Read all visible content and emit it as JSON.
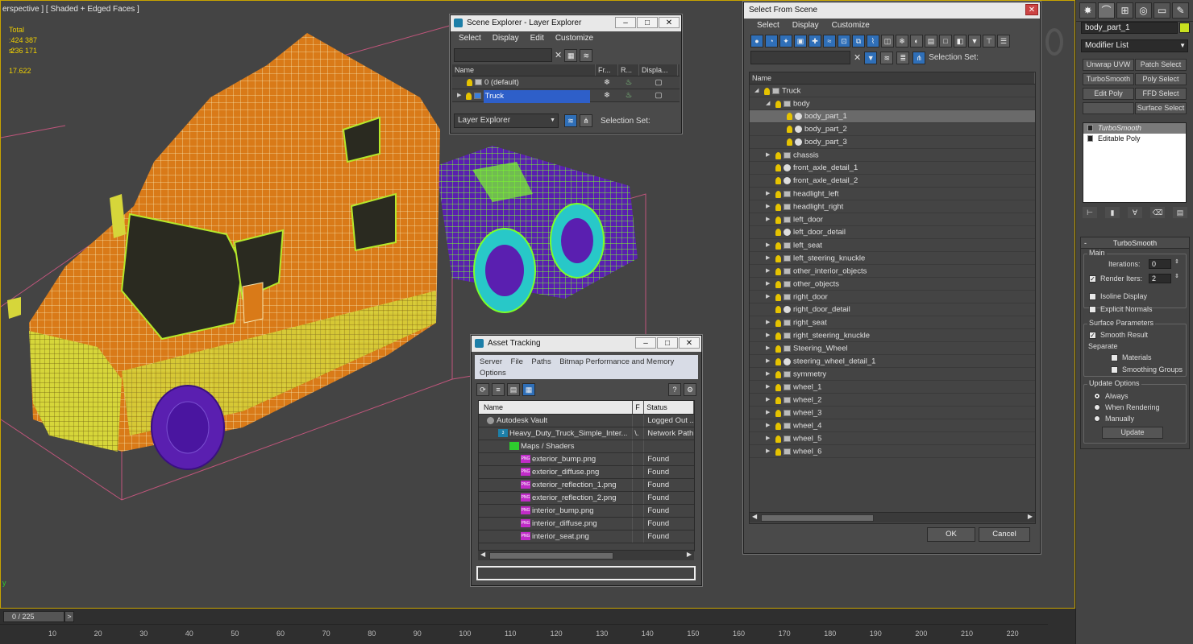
{
  "viewport": {
    "label": "erspective ] [ Shaded + Edged Faces ]",
    "stats": [
      {
        "name": "Total",
        "value": ""
      },
      {
        "name": ":",
        "value": "424 387"
      },
      {
        "name": "s:",
        "value": "236 171"
      },
      {
        "name": "",
        "value": "17.622"
      }
    ],
    "axis": "y"
  },
  "timeline": {
    "frame": "0 / 225",
    "next": ">",
    "ticks": [
      "10",
      "20",
      "30",
      "40",
      "50",
      "60",
      "70",
      "80",
      "90",
      "100",
      "110",
      "120",
      "130",
      "140",
      "150",
      "160",
      "170",
      "180",
      "190",
      "200",
      "210",
      "220"
    ]
  },
  "right_panel": {
    "tabs": [
      "sun-icon",
      "curve-icon",
      "hierarchy-icon",
      "motion-icon",
      "display-icon",
      "utilities-icon"
    ],
    "object_name": "body_part_1",
    "swatch_color": "#c8e020",
    "modifier_list": "Modifier List",
    "buttons": [
      "Unwrap UVW",
      "Patch Select",
      "TurboSmooth",
      "Poly Select",
      "Edit Poly",
      "FFD Select",
      "",
      "Surface Select"
    ],
    "stack": [
      {
        "label": "TurboSmooth",
        "selected": true
      },
      {
        "label": "Editable Poly",
        "selected": false
      }
    ],
    "rollout": {
      "title": "TurboSmooth",
      "main_group": "Main",
      "iterations_label": "Iterations:",
      "iterations_value": "0",
      "render_iters_label": "Render Iters:",
      "render_iters_value": "2",
      "isoline": "Isoline Display",
      "explicit": "Explicit Normals",
      "surface_group": "Surface Parameters",
      "smooth_result": "Smooth Result",
      "separate": "Separate",
      "materials": "Materials",
      "smoothing_groups": "Smoothing Groups",
      "update_group": "Update Options",
      "always": "Always",
      "when_rendering": "When Rendering",
      "manually": "Manually",
      "update_btn": "Update"
    }
  },
  "scene_explorer": {
    "title": "Scene Explorer - Layer Explorer",
    "menu": [
      "Select",
      "Display",
      "Edit",
      "Customize"
    ],
    "columns": [
      "Name",
      "Fr...",
      "R...",
      "Displa..."
    ],
    "rows": [
      {
        "name": "0 (default)",
        "selected": false
      },
      {
        "name": "Truck",
        "selected": true
      }
    ],
    "footer_combo": "Layer Explorer",
    "selection_set": "Selection Set:"
  },
  "asset_tracking": {
    "title": "Asset Tracking",
    "menu": [
      "Server",
      "File",
      "Paths",
      "Bitmap Performance and Memory",
      "Options"
    ],
    "columns": [
      "Name",
      "F",
      "Status"
    ],
    "rows": [
      {
        "name": "Autodesk Vault",
        "f": "",
        "status": "Logged Out ...",
        "indent": 0,
        "icon": "vault"
      },
      {
        "name": "Heavy_Duty_Truck_Simple_Inter...",
        "f": "\\.",
        "status": "Network Path",
        "indent": 1,
        "icon": "max"
      },
      {
        "name": "Maps / Shaders",
        "f": "",
        "status": "",
        "indent": 2,
        "icon": "maps"
      },
      {
        "name": "exterior_bump.png",
        "f": "",
        "status": "Found",
        "indent": 3,
        "icon": "png"
      },
      {
        "name": "exterior_diffuse.png",
        "f": "",
        "status": "Found",
        "indent": 3,
        "icon": "png"
      },
      {
        "name": "exterior_reflection_1.png",
        "f": "",
        "status": "Found",
        "indent": 3,
        "icon": "png"
      },
      {
        "name": "exterior_reflection_2.png",
        "f": "",
        "status": "Found",
        "indent": 3,
        "icon": "png"
      },
      {
        "name": "interior_bump.png",
        "f": "",
        "status": "Found",
        "indent": 3,
        "icon": "png"
      },
      {
        "name": "interior_diffuse.png",
        "f": "",
        "status": "Found",
        "indent": 3,
        "icon": "png"
      },
      {
        "name": "interior_seat.png",
        "f": "",
        "status": "Found",
        "indent": 3,
        "icon": "png"
      }
    ]
  },
  "select_from_scene": {
    "title": "Select From Scene",
    "menu": [
      "Select",
      "Display",
      "Customize"
    ],
    "column": "Name",
    "selection_set": "Selection Set:",
    "ok": "OK",
    "cancel": "Cancel",
    "tree": [
      {
        "name": "Truck",
        "level": 0,
        "exp": "open",
        "icon": "layer"
      },
      {
        "name": "body",
        "level": 1,
        "exp": "open",
        "icon": "layer"
      },
      {
        "name": "body_part_1",
        "level": 2,
        "exp": "none",
        "icon": "obj",
        "selected": true
      },
      {
        "name": "body_part_2",
        "level": 2,
        "exp": "none",
        "icon": "obj"
      },
      {
        "name": "body_part_3",
        "level": 2,
        "exp": "none",
        "icon": "obj"
      },
      {
        "name": "chassis",
        "level": 1,
        "exp": "closed",
        "icon": "layer"
      },
      {
        "name": "front_axle_detail_1",
        "level": 1,
        "exp": "none",
        "icon": "obj"
      },
      {
        "name": "front_axle_detail_2",
        "level": 1,
        "exp": "none",
        "icon": "obj"
      },
      {
        "name": "headlight_left",
        "level": 1,
        "exp": "closed",
        "icon": "layer"
      },
      {
        "name": "headlight_right",
        "level": 1,
        "exp": "closed",
        "icon": "layer"
      },
      {
        "name": "left_door",
        "level": 1,
        "exp": "closed",
        "icon": "layer"
      },
      {
        "name": "left_door_detail",
        "level": 1,
        "exp": "none",
        "icon": "obj"
      },
      {
        "name": "left_seat",
        "level": 1,
        "exp": "closed",
        "icon": "layer"
      },
      {
        "name": "left_steering_knuckle",
        "level": 1,
        "exp": "closed",
        "icon": "layer"
      },
      {
        "name": "other_interior_objects",
        "level": 1,
        "exp": "closed",
        "icon": "layer"
      },
      {
        "name": "other_objects",
        "level": 1,
        "exp": "closed",
        "icon": "layer"
      },
      {
        "name": "right_door",
        "level": 1,
        "exp": "closed",
        "icon": "layer"
      },
      {
        "name": "right_door_detail",
        "level": 1,
        "exp": "none",
        "icon": "obj"
      },
      {
        "name": "right_seat",
        "level": 1,
        "exp": "closed",
        "icon": "layer"
      },
      {
        "name": "right_steering_knuckle",
        "level": 1,
        "exp": "closed",
        "icon": "layer"
      },
      {
        "name": "Steering_Wheel",
        "level": 1,
        "exp": "closed",
        "icon": "layer"
      },
      {
        "name": "steering_wheel_detail_1",
        "level": 1,
        "exp": "closed",
        "icon": "obj"
      },
      {
        "name": "symmetry",
        "level": 1,
        "exp": "closed",
        "icon": "layer"
      },
      {
        "name": "wheel_1",
        "level": 1,
        "exp": "closed",
        "icon": "layer"
      },
      {
        "name": "wheel_2",
        "level": 1,
        "exp": "closed",
        "icon": "layer"
      },
      {
        "name": "wheel_3",
        "level": 1,
        "exp": "closed",
        "icon": "layer"
      },
      {
        "name": "wheel_4",
        "level": 1,
        "exp": "closed",
        "icon": "layer"
      },
      {
        "name": "wheel_5",
        "level": 1,
        "exp": "closed",
        "icon": "layer"
      },
      {
        "name": "wheel_6",
        "level": 1,
        "exp": "closed",
        "icon": "layer"
      }
    ]
  }
}
